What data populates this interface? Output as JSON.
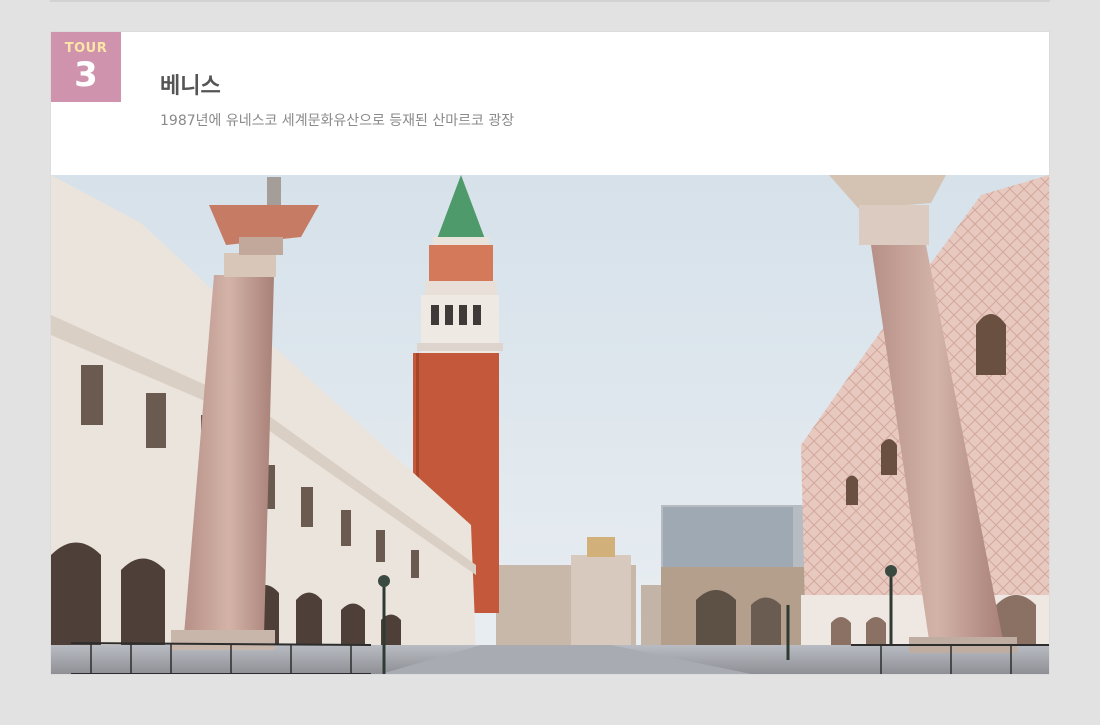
{
  "badge": {
    "label": "TOUR",
    "number": "3"
  },
  "header": {
    "title": "베니스",
    "subtitle": "1987년에 유네스코 세계문화유산으로 등재된 산마르코 광장"
  },
  "photo": {
    "icon": "venice-piazza-san-marco-photo"
  },
  "colors": {
    "badge": "#cf93ad",
    "badge_label": "#ffe6a6",
    "sky": "#dce6ee",
    "tower_brick": "#c4583a",
    "spire": "#4f9a6a"
  }
}
